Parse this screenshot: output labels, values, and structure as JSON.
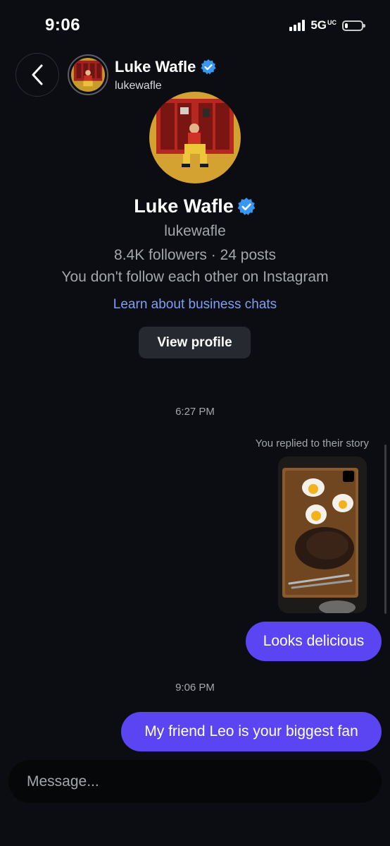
{
  "status_bar": {
    "time": "9:06",
    "network": "5G",
    "network_suffix": "UC",
    "battery_level": 0.2
  },
  "header": {
    "name": "Luke Wafle",
    "username": "lukewafle",
    "verified": true
  },
  "profile": {
    "name": "Luke Wafle",
    "username": "lukewafle",
    "stats": "8.4K followers · 24 posts",
    "follow_note": "You don't follow each other on Instagram",
    "business_link": "Learn about business chats",
    "view_profile_label": "View profile"
  },
  "chat": {
    "timestamp_1": "6:27 PM",
    "story_caption": "You replied to their story",
    "message_1": "Looks delicious",
    "timestamp_2": "9:06 PM",
    "message_2": "My friend Leo is your biggest fan"
  },
  "composer": {
    "placeholder": "Message..."
  },
  "colors": {
    "background": "#0b0d12",
    "bubble": "#5b45f2",
    "link": "#7f9ff3",
    "verified": "#3897f0"
  }
}
